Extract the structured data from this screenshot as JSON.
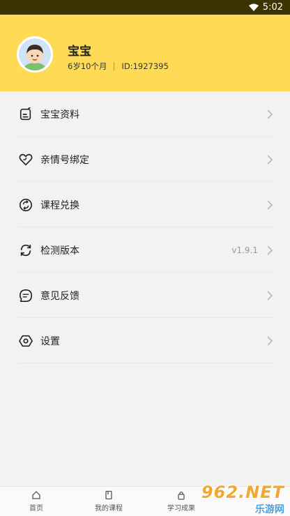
{
  "status_bar": {
    "time": "5:02"
  },
  "profile": {
    "name": "宝宝",
    "age": "6岁10个月",
    "id": "ID:1927395"
  },
  "menu": [
    {
      "label": "宝宝资料",
      "icon": "edit-doc-icon"
    },
    {
      "label": "亲情号绑定",
      "icon": "heart-link-icon"
    },
    {
      "label": "课程兑换",
      "icon": "exchange-icon"
    },
    {
      "label": "检测版本",
      "icon": "refresh-icon",
      "value": "v1.9.1"
    },
    {
      "label": "意见反馈",
      "icon": "chat-icon"
    },
    {
      "label": "设置",
      "icon": "settings-hex-icon"
    }
  ],
  "tabs": [
    {
      "label": "首页",
      "icon": "home-icon"
    },
    {
      "label": "我的课程",
      "icon": "book-icon"
    },
    {
      "label": "学习成果",
      "icon": "lock-icon"
    },
    {
      "label": "",
      "icon": ""
    }
  ],
  "watermark": {
    "top": "962.NET",
    "bottom": "乐游网"
  }
}
